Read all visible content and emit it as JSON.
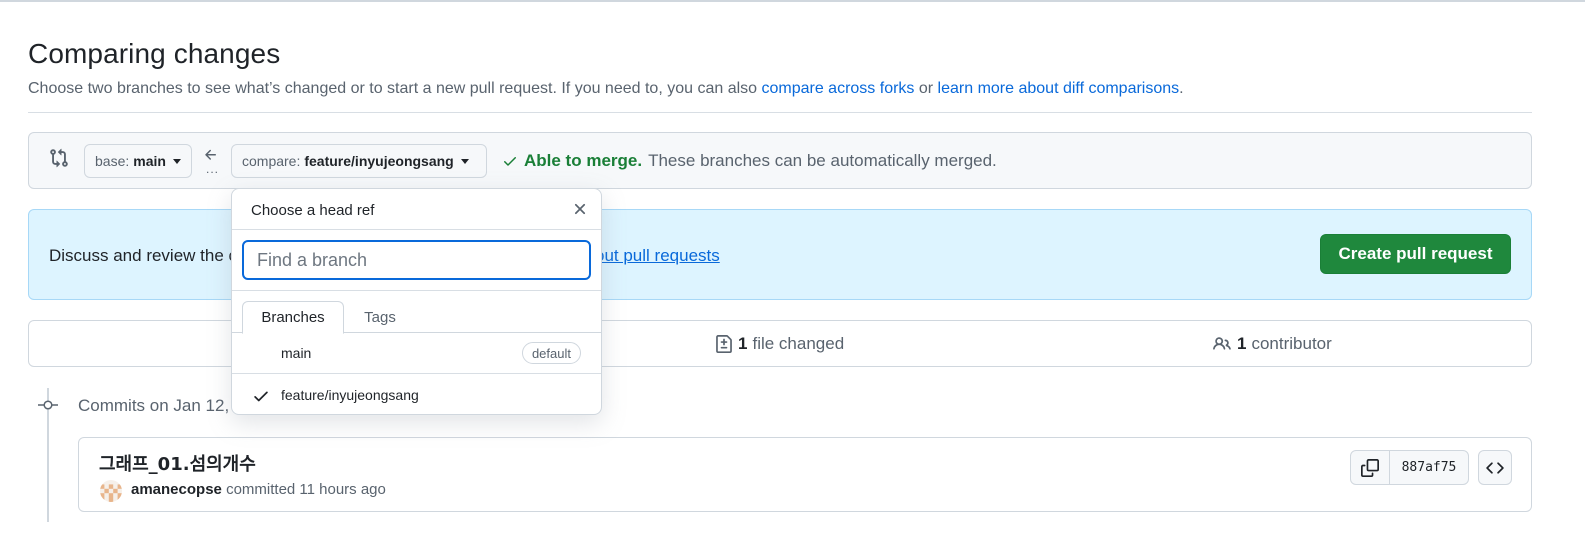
{
  "page": {
    "title": "Comparing changes",
    "subtitle_text": "Choose two branches to see what’s changed or to start a new pull request. If you need to, you can also ",
    "link_compare_forks": "compare across forks",
    "subtitle_or": " or ",
    "link_learn_diff": "learn more about diff comparisons",
    "subtitle_end": "."
  },
  "range": {
    "base_prefix": "base:",
    "base_branch": "main",
    "compare_prefix": "compare:",
    "compare_branch": "feature/inyujeongsang",
    "dots": "...",
    "merge_ok": "Able to merge.",
    "merge_detail": "These branches can be automatically merged."
  },
  "banner": {
    "text": "Discuss and review the c",
    "link": "out pull requests",
    "create_button": "Create pull request"
  },
  "stats": {
    "files_count": "1",
    "files_label": "file changed",
    "contributors_count": "1",
    "contributors_label": "contributor"
  },
  "timeline": {
    "commits_on": "Commits on Jan 12,"
  },
  "commit": {
    "message": "그래프_01.섬의개수",
    "author": "amanecopse",
    "committed_text": "committed 11 hours ago",
    "sha": "887af75"
  },
  "dropdown": {
    "title": "Choose a head ref",
    "filter_placeholder": "Find a branch",
    "filter_value": "",
    "tabs": [
      {
        "label": "Branches",
        "active": true
      },
      {
        "label": "Tags",
        "active": false
      }
    ],
    "items": [
      {
        "label": "main",
        "badge": "default",
        "selected": false
      },
      {
        "label": "feature/inyujeongsang",
        "badge": "",
        "selected": true
      }
    ]
  },
  "colors": {
    "accent_link": "#0969da",
    "success_green": "#1f883d",
    "banner_bg": "#ddf4ff"
  }
}
